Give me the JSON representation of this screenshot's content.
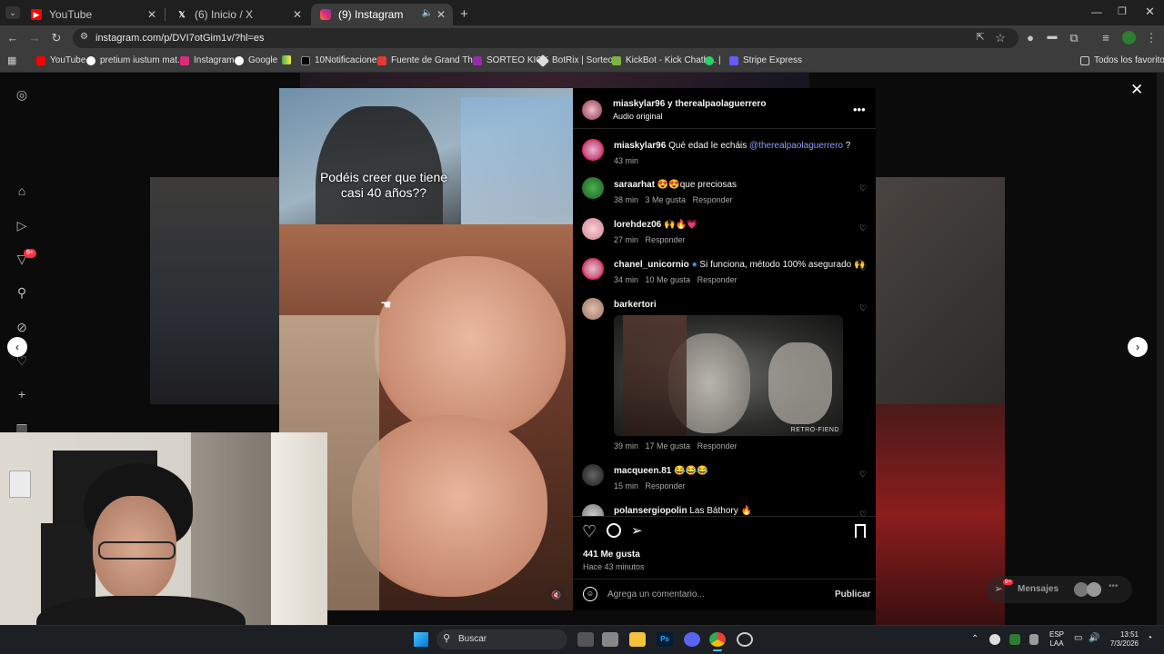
{
  "browser": {
    "tabs": [
      {
        "label": "YouTube",
        "active": false
      },
      {
        "label": "(6) Inicio / X",
        "active": false
      },
      {
        "label": "(9) Instagram",
        "active": true
      }
    ],
    "url": "instagram.com/p/DVI7otGim1v/?hl=es",
    "bookmarks": [
      "YouTube",
      "pretium iustum mat...",
      "Instagram",
      "Google",
      "10Notificaciones",
      "Fuente de Grand Th...",
      "SORTEO KICK",
      "BotRix | Sorteos",
      "KickBot - Kick Chatb...",
      "|",
      "Stripe Express"
    ],
    "all_bookmarks": "Todos los favoritos"
  },
  "sidebar": {
    "badge": "9+"
  },
  "video": {
    "caption": "Podéis creer que tiene casi 40 años??"
  },
  "post": {
    "authors": "miaskylar96 y therealpaolaguerrero",
    "audio": "Audio original",
    "caption": {
      "user": "miaskylar96",
      "text": "Qué edad le echáis",
      "mention": "@therealpaolaguerrero",
      "suffix": " ?",
      "time": "43 min"
    },
    "comments": [
      {
        "user": "saraarhat",
        "text": "😍😍que preciosas",
        "time": "38 min",
        "likes": "3 Me gusta",
        "reply": "Responder"
      },
      {
        "user": "lorehdez06",
        "text": "🙌🔥💗",
        "time": "27 min",
        "likes": "",
        "reply": "Responder"
      },
      {
        "user": "chanel_unicornio",
        "text": "Si funciona, método 100% asegurado 🙌",
        "time": "34 min",
        "likes": "10 Me gusta",
        "reply": "Responder"
      },
      {
        "user": "barkertori",
        "text": "",
        "time": "39 min",
        "likes": "17 Me gusta",
        "reply": "Responder",
        "gif_watermark": "RETRO-FIEND"
      },
      {
        "user": "macqueen.81",
        "text": "😂😂😂",
        "time": "15 min",
        "likes": "",
        "reply": "Responder"
      },
      {
        "user": "polansergiopolin",
        "text": "Las Báthory 🔥",
        "time": "",
        "likes": "",
        "reply": ""
      }
    ],
    "like_count": "441 Me gusta",
    "posted": "Hace 43 minutos",
    "comment_placeholder": "Agrega un comentario...",
    "publish": "Publicar"
  },
  "messages": "Mensajes",
  "messages_badge": "9+",
  "taskbar": {
    "search": "Buscar",
    "lang1": "ESP",
    "lang2": "LAA",
    "time": "13:51",
    "date": "7/3/2026"
  }
}
